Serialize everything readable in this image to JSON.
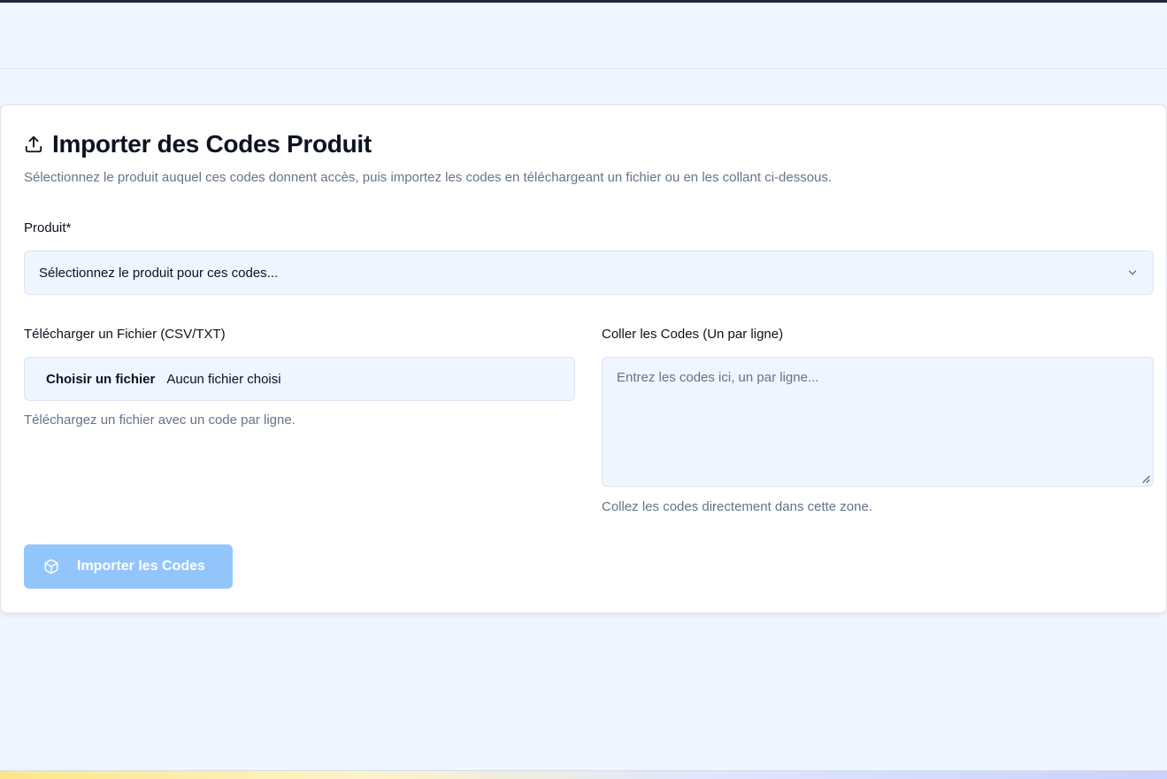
{
  "card": {
    "title": "Importer des Codes Produit",
    "title_icon": "upload-icon",
    "description": "Sélectionnez le produit auquel ces codes donnent accès, puis importez les codes en téléchargeant un fichier ou en les collant ci-dessous."
  },
  "product": {
    "label": "Produit*",
    "placeholder": "Sélectionnez le produit pour ces codes...",
    "icon": "chevron-down-icon"
  },
  "file_upload": {
    "label": "Télécharger un Fichier (CSV/TXT)",
    "button_label": "Choisir un fichier",
    "status": "Aucun fichier choisi",
    "helper": "Téléchargez un fichier avec un code par ligne."
  },
  "paste": {
    "label": "Coller les Codes (Un par ligne)",
    "placeholder": "Entrez les codes ici, un par ligne...",
    "helper": "Collez les codes directement dans cette zone."
  },
  "submit": {
    "label": "Importer les Codes",
    "icon": "package-icon",
    "disabled": true
  },
  "colors": {
    "page_bg": "#eff6ff",
    "accent_disabled": "#93c5fd",
    "muted_text": "#64748b"
  }
}
